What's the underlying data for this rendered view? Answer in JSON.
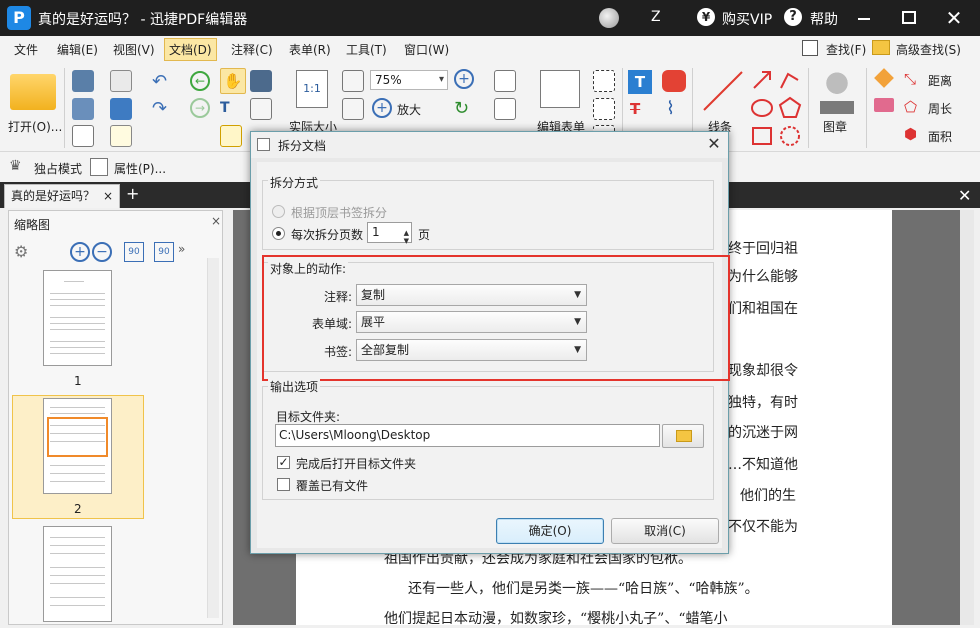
{
  "titlebar": {
    "title": "真的是好运吗？ - 迅捷PDF编辑器",
    "logo_letter": "P",
    "user": "Z",
    "vip_symbol": "¥",
    "vip_label": "购买VIP",
    "help_symbol": "?",
    "help_label": "帮助",
    "close_symbol": "✕"
  },
  "menubar": {
    "items": [
      "文件",
      "编辑(E)",
      "视图(V)",
      "文档(D)",
      "注释(C)",
      "表单(R)",
      "工具(T)",
      "窗口(W)"
    ],
    "active_index": 3,
    "find": "查找(F)",
    "advanced_find": "高级查找(S)"
  },
  "toolbar": {
    "open": "打开(O)...",
    "zoom": "75%",
    "zoom_in": "放大",
    "actual_size": "实际大小",
    "edit_form": "编辑表单",
    "line": "线条",
    "stamp": "图章",
    "distance": "距离",
    "perimeter": "周长",
    "area": "面积"
  },
  "subbar": {
    "exclusive_mode": "独占模式",
    "properties": "属性(P)..."
  },
  "tabs": {
    "doc_tab": "真的是好运吗？",
    "close": "×",
    "add": "+"
  },
  "thumbnails": {
    "title": "缩略图",
    "close": "×",
    "pages": [
      "1",
      "2"
    ]
  },
  "document": {
    "lines": [
      "终于回归祖",
      "为什么能够",
      "们和祖国在",
      "现象却很令",
      "独特，有时",
      "的沉迷于网",
      "…不知道他",
      "他们的生",
      "不仅不能为",
      "祖国作出贡献，还会成为家庭和社会国家的包袱。",
      "还有一些人，他们是另类一族——“哈日族”、“哈韩族”。",
      "他们提起日本动漫，如数家珍，“樱桃小丸子”、“蜡笔小"
    ]
  },
  "dialog": {
    "title": "拆分文档",
    "close": "✕",
    "split_method": {
      "legend": "拆分方式",
      "by_bookmark": "根据顶层书签拆分",
      "by_pages": "每次拆分页数",
      "pages_value": "1",
      "pages_unit": "页"
    },
    "actions": {
      "legend": "对象上的动作:",
      "annotation_label": "注释:",
      "annotation_value": "复制",
      "form_label": "表单域:",
      "form_value": "展平",
      "bookmark_label": "书签:",
      "bookmark_value": "全部复制"
    },
    "output": {
      "legend": "输出选项",
      "target_label": "目标文件夹:",
      "target_value": "C:\\Users\\Mloong\\Desktop",
      "open_after": "完成后打开目标文件夹",
      "open_after_checked": true,
      "overwrite": "覆盖已有文件",
      "overwrite_checked": false
    },
    "ok": "确定(O)",
    "cancel": "取消(C)"
  },
  "colors": {
    "titlebar": "#1f1f1f",
    "highlight": "#e4342c",
    "selection": "#fdefc8",
    "accent": "#1e88e5"
  }
}
